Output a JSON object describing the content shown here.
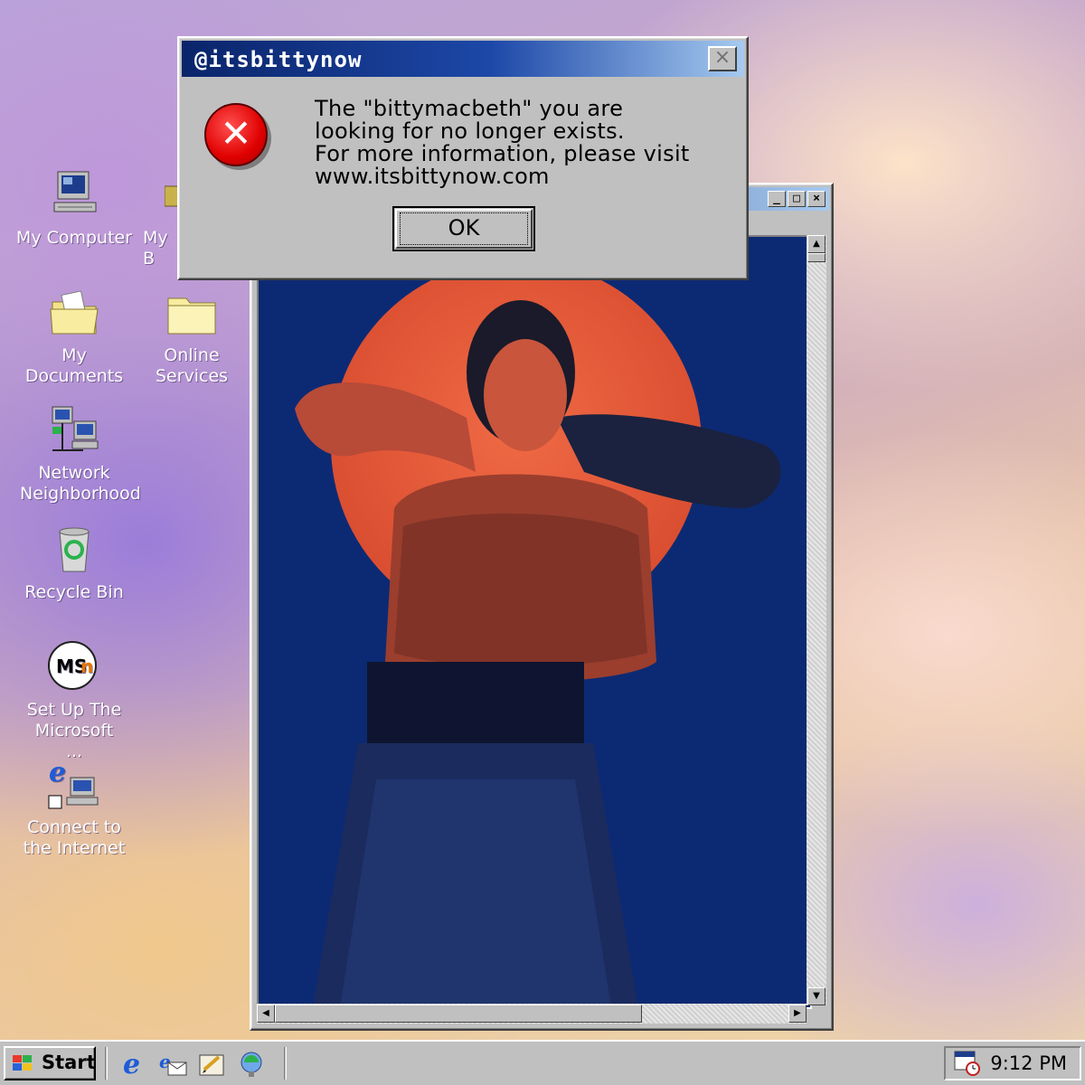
{
  "desktop": {
    "icons": [
      {
        "label": "My Computer",
        "icon": "my-computer-icon"
      },
      {
        "label": "My B",
        "icon": "my-briefcase-icon"
      },
      {
        "label": "My Documents",
        "icon": "my-documents-icon"
      },
      {
        "label": "Online Services",
        "icon": "online-services-folder-icon"
      },
      {
        "label": "Network Neighborhood",
        "icon": "network-neighborhood-icon"
      },
      {
        "label": "Recycle Bin",
        "icon": "recycle-bin-icon"
      },
      {
        "label": "Set Up The Microsoft ...",
        "icon": "msn-icon"
      },
      {
        "label": "Connect to the Internet",
        "icon": "connect-internet-icon"
      }
    ]
  },
  "image_window": {
    "controls": {
      "minimize": "_",
      "maximize": "□",
      "close": "×"
    },
    "content": "photo"
  },
  "dialog": {
    "title": "@itsbittynow",
    "close_label": "×",
    "message": [
      "The \"bittymacbeth\" you are",
      "looking for no longer exists.",
      "For more information, please visit",
      "www.itsbittynow.com"
    ],
    "ok_label": "OK",
    "icon": "error-icon"
  },
  "taskbar": {
    "start_label": "Start",
    "quick_launch": [
      "internet-explorer-icon",
      "outlook-express-icon",
      "show-desktop-icon",
      "channels-icon"
    ],
    "clock": "9:12 PM",
    "tray_icon": "scheduler-icon"
  },
  "colors": {
    "titlebar_start": "#0a246a",
    "titlebar_end": "#a6caf0",
    "window_face": "#c0c0c0",
    "photo_background": "#0c2a73",
    "sun_disc": "#e2583a"
  }
}
